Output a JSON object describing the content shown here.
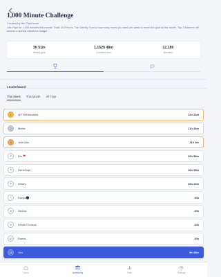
{
  "header": {
    "title": "1,000 Minute Challenge",
    "subtitle": "Created by the Flipd team",
    "description": "Use Flipd for 1,000 minutes this month! Thats 16.6 hours. The Weekly Goal is how many hours you need per week to reach the goal for the month. Top 3 finishers will receive a special milestone badge!"
  },
  "stats": [
    {
      "value": "3h 51m",
      "label": "Weekly goal"
    },
    {
      "value": "1,152h 48m",
      "label": "Combined time"
    },
    {
      "value": "12,189",
      "label": "Members"
    }
  ],
  "leaderboard": {
    "title": "Leaderboard",
    "tabs": [
      "This Week",
      "This Month",
      "All Time"
    ],
    "rows": [
      {
        "rank": "1",
        "name": "@77691fdnddler",
        "time": "12h 23m"
      },
      {
        "rank": "2",
        "name": "Meike",
        "time": "11h 43m"
      },
      {
        "rank": "3",
        "name": "Julie Ann",
        "time": "11h 3m"
      },
      {
        "rank": "4",
        "name": "Lilo 🚩",
        "time": "10h 58m"
      },
      {
        "rank": "5",
        "name": "HeHrSinjd",
        "time": "10h 15m"
      },
      {
        "rank": "6",
        "name": "Athary",
        "time": "10h 10m"
      },
      {
        "rank": "7",
        "name": "Donya🌑",
        "time": "10h"
      },
      {
        "rank": "8",
        "name": "Nedow",
        "time": "10h"
      },
      {
        "rank": "9",
        "name": "Kirstin Cholsos",
        "time": "10h"
      },
      {
        "rank": "10",
        "name": "Ramis",
        "time": "10h"
      },
      {
        "rank": "11",
        "name": "You",
        "time": "9h 45m"
      }
    ]
  },
  "nav": [
    {
      "label": "Home",
      "icon": "home-icon"
    },
    {
      "label": "community",
      "icon": "community-icon"
    },
    {
      "label": "Stats",
      "icon": "stats-icon"
    },
    {
      "label": "Settings",
      "icon": "settings-icon"
    }
  ],
  "colors": {
    "accent": "#3b5bdb",
    "gold": "#f4b84b",
    "silver": "#c9ccdb",
    "bronze": "#f4a765"
  }
}
